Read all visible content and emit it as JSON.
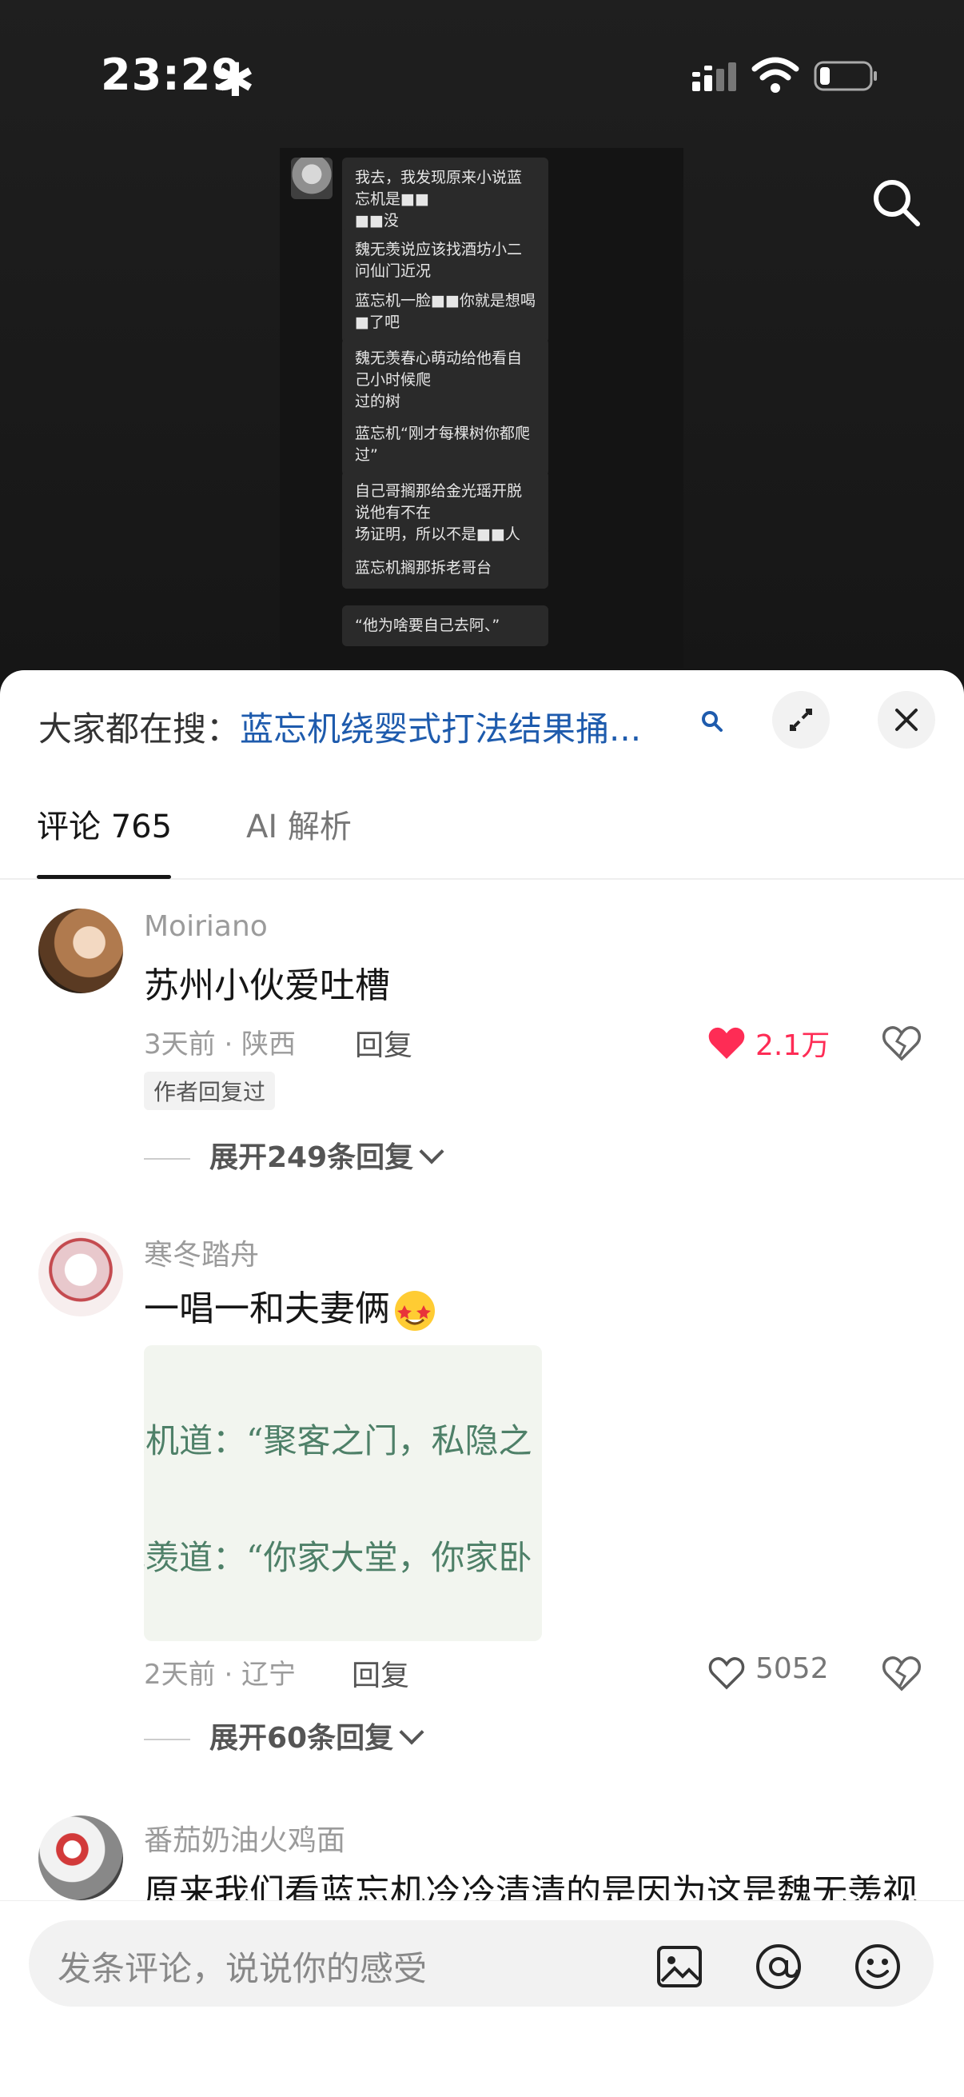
{
  "status": {
    "time": "23:29",
    "extra": "✱"
  },
  "video_chat": [
    {
      "text": "我去，我发现原来小说蓝忘机是■■\n■■没"
    },
    {
      "text": "魏无羡说应该找酒坊小二问仙门近况"
    },
    {
      "text": "蓝忘机一脸■■你就是想喝■了吧"
    },
    {
      "text": "魏无羡春心萌动给他看自己小时候爬\n过的树"
    },
    {
      "text": "蓝忘机“刚才每棵树你都爬过”"
    },
    {
      "text": "自己哥搁那给金光瑶开脱说他有不在\n场证明，所以不是■■人"
    },
    {
      "text": "蓝忘机搁那拆老哥台"
    },
    {
      "text": "“他为啥要自己去阿、”"
    }
  ],
  "sheet": {
    "trend_prefix": "大家都在搜：",
    "trend_query": "蓝忘机绕婴式打法结果捅...",
    "tabs": [
      {
        "label": "评论 765",
        "active": true
      },
      {
        "label": "AI 解析",
        "active": false
      }
    ]
  },
  "comments": [
    {
      "user": "Moiriano",
      "text": "苏州小伙爱吐槽",
      "meta": "3天前 · 陕西",
      "reply": "回复",
      "likes": "2.1万",
      "liked": true,
      "badge": "作者回复过",
      "expand": "展开249条回复"
    },
    {
      "user": "寒冬踏舟",
      "text": "一唱一和夫妻俩",
      "image_lines": [
        "忘机道：“聚客之门，私隐之",
        "无羡道：“你家大堂，你家卧"
      ],
      "meta": "2天前 · 辽宁",
      "reply": "回复",
      "likes": "5052",
      "liked": false,
      "expand": "展开60条回复"
    },
    {
      "user": "番茄奶油火鸡面",
      "text": "原来我们看蓝忘机冷冷清清的是因为这是魏无羡视"
    }
  ],
  "input": {
    "placeholder": "发条评论，说说你的感受"
  },
  "colors": {
    "accent_link": "#1e5bad",
    "like_red": "#fe2c55"
  }
}
